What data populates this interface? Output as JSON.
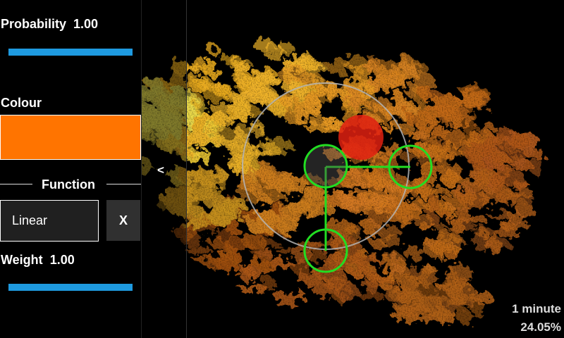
{
  "probability": {
    "label": "Probability",
    "value": "1.00",
    "level": 1.0
  },
  "colour": {
    "label": "Colour",
    "hex": "#ff7400"
  },
  "function": {
    "header": "Function",
    "selected": "Linear",
    "remove_label": "X"
  },
  "weight": {
    "label": "Weight",
    "value": "1.00",
    "level": 1.0
  },
  "panel": {
    "collapse_glyph": "<"
  },
  "status": {
    "elapsed": "1 minute",
    "progress": "24.05%"
  },
  "colors": {
    "slider": "#1e9ae0",
    "handle": "#22dd22",
    "center": "#e02010",
    "ring": "#b4b4b4"
  },
  "icons": {
    "collapse": "chevron-left-icon"
  }
}
